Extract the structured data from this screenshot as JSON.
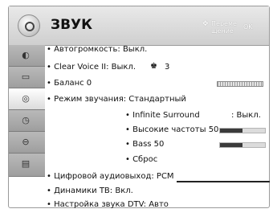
{
  "header": {
    "title": "ЗВУК",
    "hint_move": "Переме\nщение",
    "hint_ok": "OK"
  },
  "menu": {
    "auto_volume": "• Автогромкость: Выкл.",
    "clear_voice": "• Clear Voice II: Выкл.",
    "clear_voice_level": "3",
    "balance": "• Баланс 0",
    "sound_mode": "• Режим звучания: Стандартный",
    "infinite_surround": "• Infinite Surround",
    "infinite_surround_value": ": Выкл.",
    "treble": "• Высокие частоты 50",
    "bass": "• Bass 50",
    "reset": "• Сброс",
    "digital_out": "• Цифровой аудиовыход: PCM",
    "tv_speakers": "• Динамики ТВ: Вкл.",
    "dtv_sound": "• Настройка звука DTV: Авто"
  },
  "levels": {
    "treble": 0.5,
    "bass": 0.5
  },
  "sidebar": {
    "items": [
      {
        "icon": "picture-icon"
      },
      {
        "icon": "screen-icon"
      },
      {
        "icon": "sound-icon"
      },
      {
        "icon": "time-icon"
      },
      {
        "icon": "lock-icon"
      },
      {
        "icon": "option-icon"
      }
    ]
  }
}
